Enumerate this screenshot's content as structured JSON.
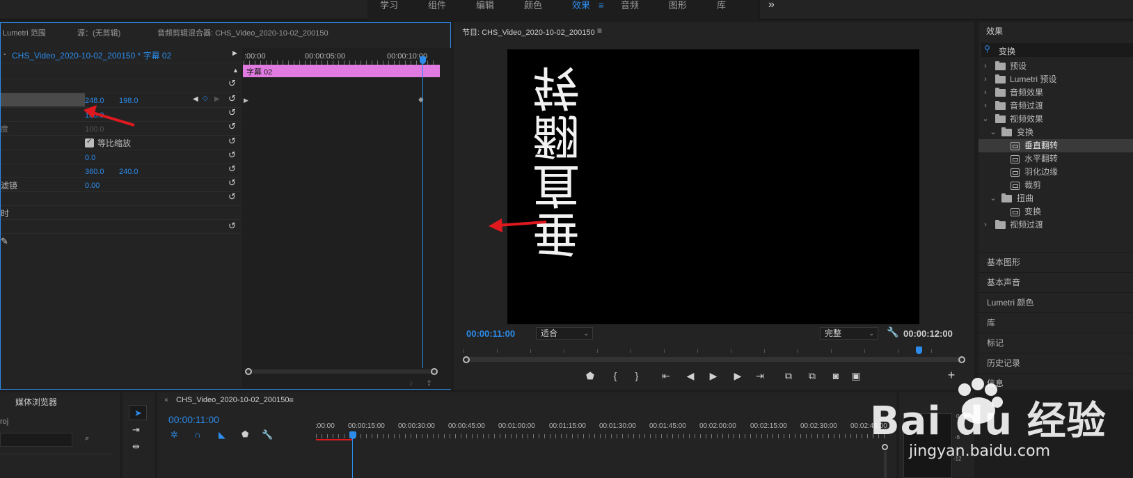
{
  "workspaces": [
    "学习",
    "组件",
    "编辑",
    "颜色",
    "效果",
    "音频",
    "图形",
    "库"
  ],
  "workspace_active_index": 4,
  "more_icon": "»",
  "source_tabs": {
    "lumetri": "Lumetri 范围",
    "source": "源：(无剪辑)",
    "audio_mixer": "音频剪辑混合器: CHS_Video_2020-10-02_200150"
  },
  "effect_controls": {
    "clip_label": "CHS_Video_2020-10-02_200150 * 字幕 02",
    "timecodes": [
      ":00:00",
      "00:00:05:00",
      "00:00:10:00"
    ],
    "clip_bar_label": "字幕 02",
    "values": {
      "position_x": "248.0",
      "position_y": "198.0",
      "scale": "100.0",
      "scale_width": "100.0",
      "scale_width_label": "度",
      "uniform_scale_label": "等比缩放",
      "rotation": "0.0",
      "anchor_x": "360.0",
      "anchor_y": "240.0",
      "antiflicker_label": "滤镜",
      "antiflicker": "0.00",
      "time_label": "时"
    }
  },
  "program_monitor": {
    "title": "节目: CHS_Video_2020-10-02_200150",
    "current_time": "00:00:11:00",
    "fit_label": "适合",
    "quality_label": "完整",
    "duration": "00:00:12:00",
    "frame_text": "垂直翻转"
  },
  "effects_panel": {
    "title": "效果",
    "search_value": "变换",
    "tree": [
      {
        "label": "预设",
        "level": 0,
        "type": "folder-star",
        "expanded": false
      },
      {
        "label": "Lumetri 预设",
        "level": 0,
        "type": "folder-star",
        "expanded": false
      },
      {
        "label": "音频效果",
        "level": 0,
        "type": "folder",
        "expanded": false
      },
      {
        "label": "音频过渡",
        "level": 0,
        "type": "folder",
        "expanded": false
      },
      {
        "label": "视频效果",
        "level": 0,
        "type": "folder",
        "expanded": true
      },
      {
        "label": "变换",
        "level": 1,
        "type": "folder",
        "expanded": true
      },
      {
        "label": "垂直翻转",
        "level": 2,
        "type": "effect",
        "selected": true
      },
      {
        "label": "水平翻转",
        "level": 2,
        "type": "effect"
      },
      {
        "label": "羽化边缘",
        "level": 2,
        "type": "effect"
      },
      {
        "label": "裁剪",
        "level": 2,
        "type": "effect"
      },
      {
        "label": "扭曲",
        "level": 1,
        "type": "folder",
        "expanded": true
      },
      {
        "label": "变换",
        "level": 2,
        "type": "effect"
      },
      {
        "label": "视频过渡",
        "level": 0,
        "type": "folder",
        "expanded": false
      }
    ],
    "side_links": [
      "基本图形",
      "基本声音",
      "Lumetri 颜色",
      "库",
      "标记",
      "历史记录",
      "信息"
    ]
  },
  "project_panel": {
    "tab": "媒体浏览器",
    "project_label": "roj"
  },
  "timeline": {
    "title": "CHS_Video_2020-10-02_200150",
    "current_time": "00:00:11:00",
    "ruler_labels": [
      ":00:00",
      "00:00:15:00",
      "00:00:30:00",
      "00:00:45:00",
      "00:01:00:00",
      "00:01:15:00",
      "00:01:30:00",
      "00:01:45:00",
      "00:02:00:00",
      "00:02:15:00",
      "00:02:30:00",
      "00:02:45:00"
    ]
  },
  "audio_meter": {
    "labels": [
      "0",
      "-6",
      "-12"
    ]
  },
  "watermark": {
    "brand": "Bai du 经验",
    "url": "jingyan.baidu.com"
  },
  "colors": {
    "accent": "#2d8ceb",
    "clip_pink": "#e17be1",
    "arrow_red": "#e0191f",
    "panel_bg": "#232323"
  }
}
